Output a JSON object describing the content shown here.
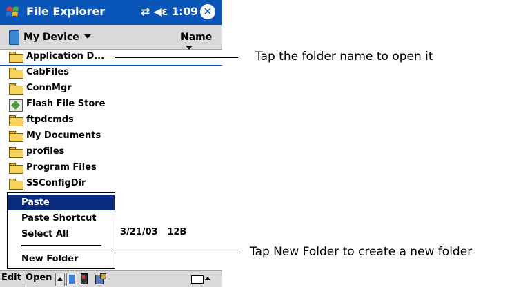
{
  "title_bar": {
    "app_title": "File Explorer",
    "status": "⇄ ◀ε 1:09",
    "close_glyph": "✕",
    "start_icon": "windows-flag-icon"
  },
  "location_bar": {
    "location": "My Device",
    "sort_label": "Name"
  },
  "files": [
    {
      "name": "Application D...",
      "icon": "folder-icon"
    },
    {
      "name": "CabFiles",
      "icon": "folder-icon"
    },
    {
      "name": "ConnMgr",
      "icon": "folder-icon"
    },
    {
      "name": "Flash File Store",
      "icon": "storage-card-icon"
    },
    {
      "name": "ftpdcmds",
      "icon": "folder-icon"
    },
    {
      "name": "My Documents",
      "icon": "folder-icon"
    },
    {
      "name": "profiles",
      "icon": "folder-icon"
    },
    {
      "name": "Program Files",
      "icon": "folder-icon"
    },
    {
      "name": "SSConfigDir",
      "icon": "folder-icon"
    }
  ],
  "detail": {
    "date": "3/21/03",
    "size": "12B"
  },
  "context_menu": {
    "items": [
      "Paste",
      "Paste Shortcut",
      "Select All",
      "New Folder"
    ],
    "highlighted": "Paste"
  },
  "bottom_bar": {
    "edit": "Edit",
    "open": "Open"
  },
  "callouts": {
    "folder_name": "Tap the folder name to open it",
    "new_folder": "Tap New Folder to create a new folder"
  },
  "colors": {
    "title_bar": "#0a55b8",
    "menu_highlight": "#0a2a7e",
    "bar_gray": "#d9d9d9"
  }
}
